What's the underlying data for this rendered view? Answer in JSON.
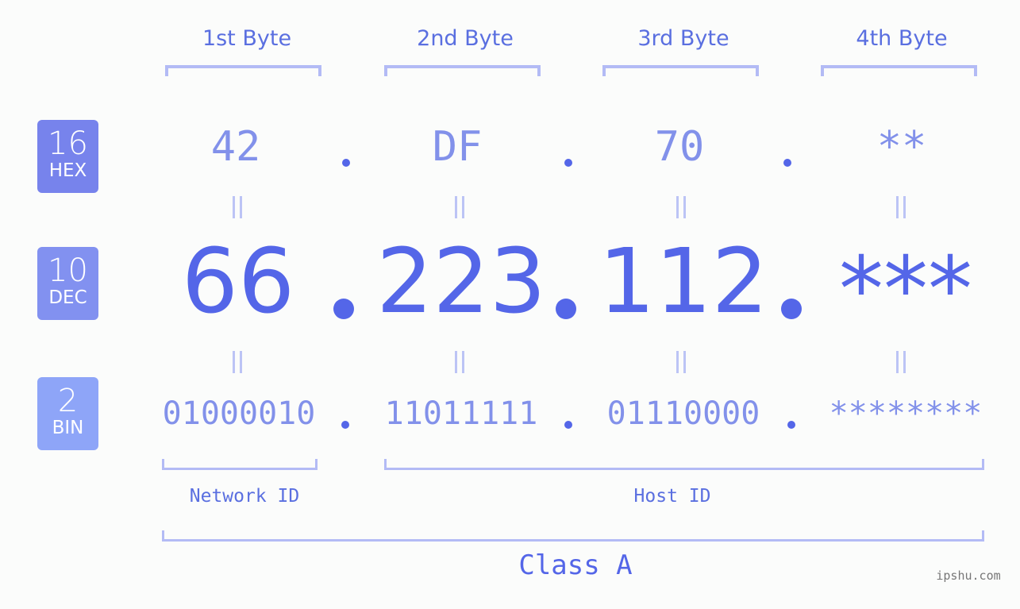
{
  "headers": [
    "1st Byte",
    "2nd Byte",
    "3rd Byte",
    "4th Byte"
  ],
  "badges": [
    {
      "base": "16",
      "name": "HEX",
      "color": "#7783ec"
    },
    {
      "base": "10",
      "name": "DEC",
      "color": "#8291f0"
    },
    {
      "base": "2",
      "name": "BIN",
      "color": "#8ea5f8"
    }
  ],
  "hex": [
    "42",
    "DF",
    "70",
    "**"
  ],
  "dec": [
    "66",
    "223",
    "112",
    "***"
  ],
  "bin": [
    "01000010",
    "11011111",
    "01110000",
    "********"
  ],
  "separator": ".",
  "labels": {
    "network_id": "Network ID",
    "host_id": "Host ID",
    "class": "Class A"
  },
  "watermark": "ipshu.com"
}
